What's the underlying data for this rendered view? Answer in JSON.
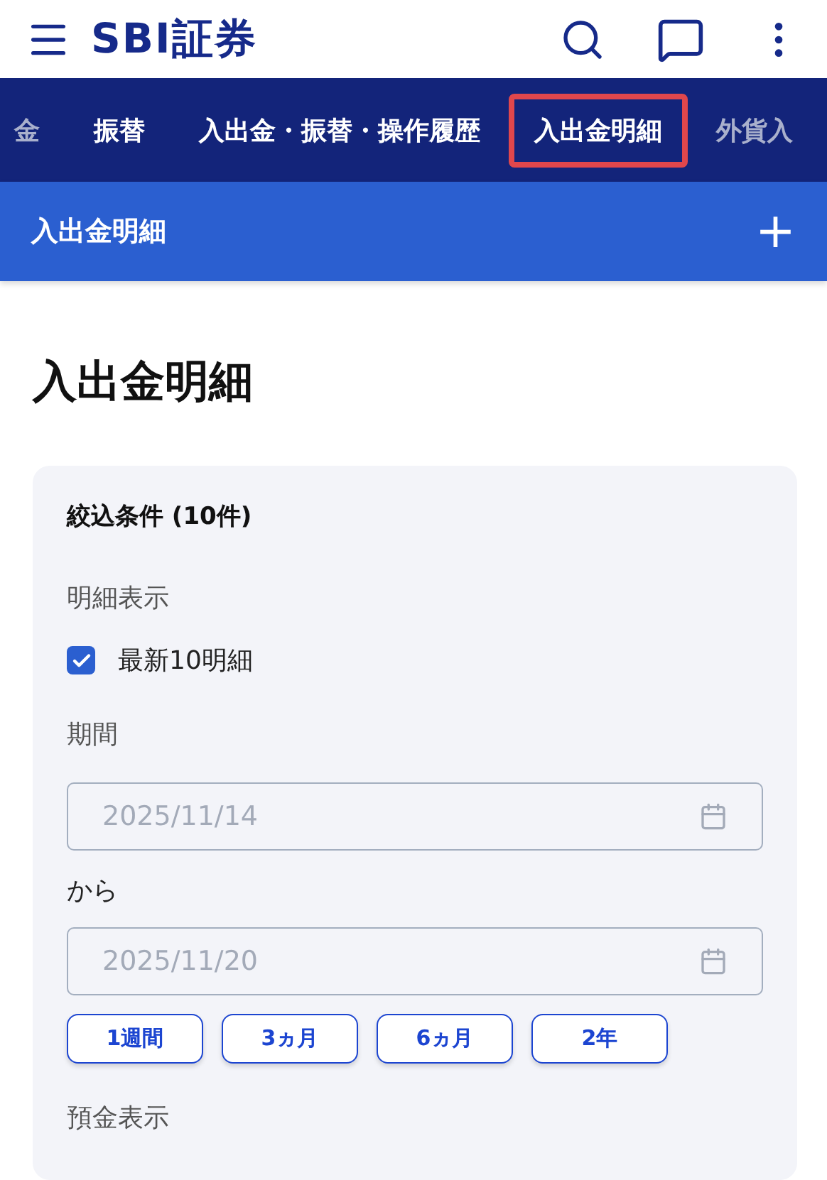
{
  "header": {
    "logo": "SBI証券"
  },
  "tabs": [
    {
      "label": "金",
      "selected": false
    },
    {
      "label": "振替",
      "selected": false
    },
    {
      "label": "入出金・振替・操作履歴",
      "selected": false
    },
    {
      "label": "入出金明細",
      "selected": true
    },
    {
      "label": "外貨入",
      "selected": false
    }
  ],
  "section_bar": {
    "title": "入出金明細",
    "expand": "+"
  },
  "page_title": "入出金明細",
  "filter": {
    "heading": "絞込条件 (10件)",
    "detail_label": "明細表示",
    "latest": {
      "label": "最新10明細",
      "checked": true
    },
    "period_label": "期間",
    "date_from": {
      "value": "2025/11/14"
    },
    "range_word": "から",
    "date_to": {
      "value": "2025/11/20"
    },
    "presets": [
      "1週間",
      "3ヵ月",
      "6ヵ月",
      "2年"
    ],
    "deposit_label": "預金表示"
  }
}
